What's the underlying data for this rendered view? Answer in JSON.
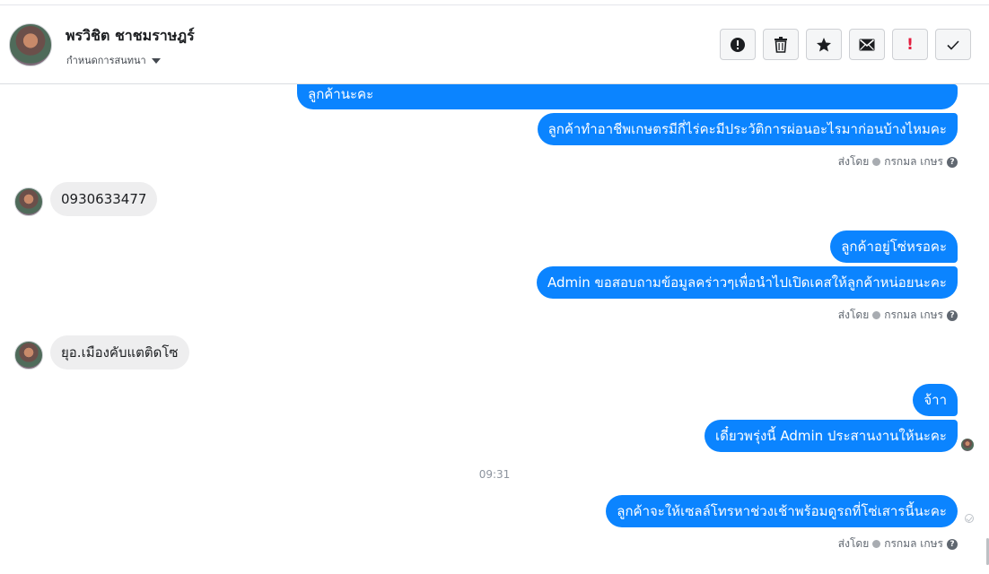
{
  "header": {
    "name": "พรวิชิต ชาชมราษฎร์",
    "assign_label": "กำหนดการสนทนา"
  },
  "toolbar": {
    "buttons": [
      {
        "icon": "alert-circle-icon"
      },
      {
        "icon": "trash-icon"
      },
      {
        "icon": "star-icon"
      },
      {
        "icon": "envelope-icon"
      },
      {
        "icon": "exclamation-icon",
        "color": "#e41e3f",
        "label": "!"
      },
      {
        "icon": "check-icon"
      }
    ]
  },
  "messages": {
    "out_1": "ลูกค้านะคะ",
    "out_2": "ลูกค้าทำอาชีพเกษตรมีกี่ไร่คะมีประวัติการผ่อนอะไรมาก่อนบ้างไหมคะ",
    "sent_by_1": {
      "prefix": "ส่งโดย",
      "agent": "กรกมล เกษร"
    },
    "in_1": "0930633477",
    "out_3": "ลูกค้าอยู่โซ่หรอคะ",
    "out_4": "Admin ขอสอบถามข้อมูลคร่าวๆเพื่อนำไปเปิดเคสให้ลูกค้าหน่อยนะคะ",
    "sent_by_2": {
      "prefix": "ส่งโดย",
      "agent": "กรกมล เกษร"
    },
    "in_2": "ยุอ.เมืองคับแตติดโซ",
    "out_5": "จ้าา",
    "out_6": "เดี๋ยวพรุ่งนี้ Admin ประสานงานให้นะคะ",
    "time_separator": "09:31",
    "out_7": "ลูกค้าจะให้เซลล์โทรหาช่วงเช้าพร้อมดูรถที่โซ่เสารนี้นะคะ",
    "sent_by_3": {
      "prefix": "ส่งโดย",
      "agent": "กรกมล เกษร"
    }
  },
  "colors": {
    "outgoing_bubble": "#0b84ff",
    "incoming_bubble": "#eeeeef",
    "danger": "#e41e3f"
  }
}
